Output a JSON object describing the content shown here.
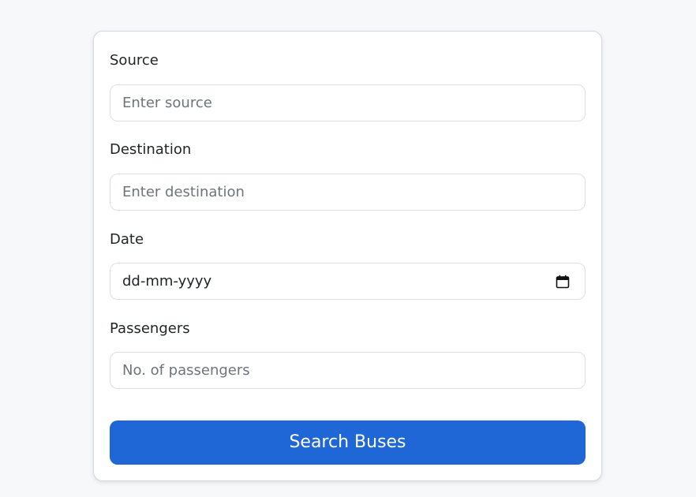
{
  "form": {
    "source": {
      "label": "Source",
      "placeholder": "Enter source"
    },
    "destination": {
      "label": "Destination",
      "placeholder": "Enter destination"
    },
    "date": {
      "label": "Date",
      "placeholder": "dd-mm-yyyy",
      "icon": "calendar-icon"
    },
    "passengers": {
      "label": "Passengers",
      "placeholder": "No. of passengers"
    },
    "submit_label": "Search Buses"
  },
  "colors": {
    "page_background": "#f7f8fa",
    "card_background": "#ffffff",
    "accent": "#1f66d6",
    "placeholder": "#6c757d",
    "text": "#212529"
  }
}
